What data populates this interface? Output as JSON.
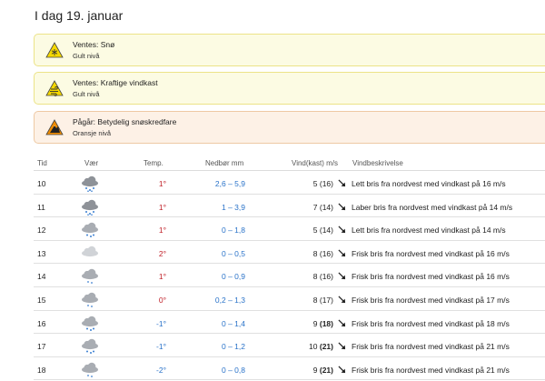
{
  "page_title": "I dag 19. januar",
  "warnings": [
    {
      "title": "Ventes: Snø",
      "level": "Gult nivå",
      "icon": "snow-warning-icon",
      "color": "yellow"
    },
    {
      "title": "Ventes: Kraftige vindkast",
      "level": "Gult nivå",
      "icon": "wind-warning-icon",
      "color": "yellow"
    },
    {
      "title": "Pågår: Betydelig snøskredfare",
      "level": "Oransje nivå",
      "icon": "avalanche-warning-icon",
      "color": "orange"
    }
  ],
  "table": {
    "headers": {
      "tid": "Tid",
      "vaer": "Vær",
      "temp": "Temp.",
      "nedbor": "Nedbør mm",
      "vind": "Vind(kast) m/s",
      "desc": "Vindbeskrivelse"
    },
    "rows": [
      {
        "tid": "10",
        "icon": "dark-cloud-snow-icon",
        "temp": "1°",
        "nedbor": "2,6 – 5,9",
        "vind": "5",
        "kast": "(16)",
        "kast_bold": false,
        "desc": "Lett bris fra nordvest med vindkast på 16 m/s"
      },
      {
        "tid": "11",
        "icon": "dark-cloud-snow-icon",
        "temp": "1°",
        "nedbor": "1 – 3,9",
        "vind": "7",
        "kast": "(14)",
        "kast_bold": false,
        "desc": "Laber bris fra nordvest med vindkast på 14 m/s"
      },
      {
        "tid": "12",
        "icon": "cloud-snow-icon",
        "temp": "1°",
        "nedbor": "0 – 1,8",
        "vind": "5",
        "kast": "(14)",
        "kast_bold": false,
        "desc": "Lett bris fra nordvest med vindkast på 14 m/s"
      },
      {
        "tid": "13",
        "icon": "light-cloud-icon",
        "temp": "2°",
        "nedbor": "0 – 0,5",
        "vind": "8",
        "kast": "(16)",
        "kast_bold": false,
        "desc": "Frisk bris fra nordvest med vindkast på 16 m/s"
      },
      {
        "tid": "14",
        "icon": "cloud-light-snow-icon",
        "temp": "1°",
        "nedbor": "0 – 0,9",
        "vind": "8",
        "kast": "(16)",
        "kast_bold": false,
        "desc": "Frisk bris fra nordvest med vindkast på 16 m/s"
      },
      {
        "tid": "15",
        "icon": "cloud-light-snow-icon",
        "temp": "0°",
        "nedbor": "0,2 – 1,3",
        "vind": "8",
        "kast": "(17)",
        "kast_bold": false,
        "desc": "Frisk bris fra nordvest med vindkast på 17 m/s"
      },
      {
        "tid": "16",
        "icon": "cloud-snow-icon",
        "temp": "-1°",
        "nedbor": "0 – 1,4",
        "vind": "9",
        "kast": "(18)",
        "kast_bold": true,
        "desc": "Frisk bris fra nordvest med vindkast på 18 m/s"
      },
      {
        "tid": "17",
        "icon": "cloud-snow-icon",
        "temp": "-1°",
        "nedbor": "0 – 1,2",
        "vind": "10",
        "kast": "(21)",
        "kast_bold": true,
        "desc": "Frisk bris fra nordvest med vindkast på 21 m/s"
      },
      {
        "tid": "18",
        "icon": "cloud-light-snow-icon",
        "temp": "-2°",
        "nedbor": "0 – 0,8",
        "vind": "9",
        "kast": "(21)",
        "kast_bold": true,
        "desc": "Frisk bris fra nordvest med vindkast på 21 m/s"
      }
    ]
  },
  "colors": {
    "warm": "#c0222a",
    "cold": "#2a73c9",
    "precip": "#2a73c9",
    "yellow_bg": "#fcfbe3",
    "orange_bg": "#fdf1e6"
  }
}
